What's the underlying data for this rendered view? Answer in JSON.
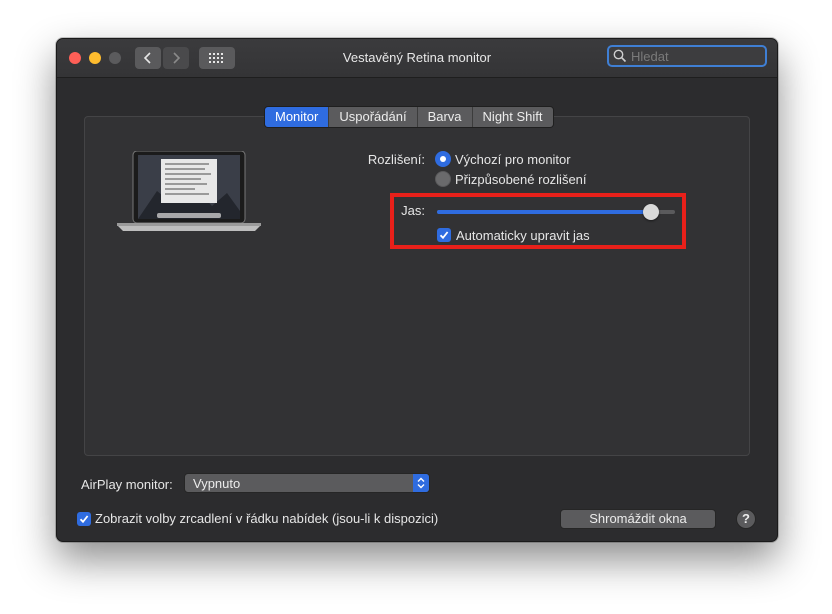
{
  "window": {
    "title": "Vestavěný Retina monitor"
  },
  "search": {
    "placeholder": "Hledat"
  },
  "tabs": [
    {
      "label": "Monitor",
      "active": true
    },
    {
      "label": "Uspořádání",
      "active": false
    },
    {
      "label": "Barva",
      "active": false
    },
    {
      "label": "Night Shift",
      "active": false
    }
  ],
  "resolution": {
    "label": "Rozlišení:",
    "options": [
      {
        "label": "Výchozí pro monitor",
        "selected": true
      },
      {
        "label": "Přizpůsobené rozlišení",
        "selected": false
      }
    ]
  },
  "brightness": {
    "label": "Jas:",
    "value": 0.9,
    "auto_label": "Automaticky upravit jas",
    "auto_checked": true
  },
  "airplay": {
    "label": "AirPlay monitor:",
    "value": "Vypnuto"
  },
  "mirror": {
    "label": "Zobrazit volby zrcadlení v řádku nabídek (jsou-li k dispozici)",
    "checked": true
  },
  "gather_button": {
    "label": "Shromáždit okna"
  },
  "help_button": {
    "label": "?"
  },
  "colors": {
    "accent": "#2f6ce0",
    "highlight": "#e8201a",
    "window_bg": "#2c2c2e"
  },
  "icons": [
    "chevron-left-icon",
    "chevron-right-icon",
    "grid-icon",
    "search-icon",
    "checkmark-icon",
    "chevron-updown-icon",
    "laptop-icon"
  ]
}
